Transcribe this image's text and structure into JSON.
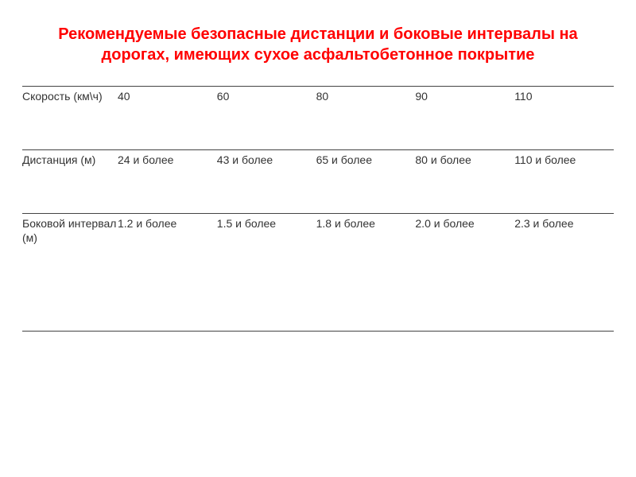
{
  "title": "Рекомендуемые безопасные дистанции и боковые интервалы на дорогах, имеющих сухое асфальтобетонное покрытие",
  "rows": [
    {
      "label": "Скорость (км\\ч)",
      "cells": [
        "40",
        "60",
        "80",
        "90",
        "110"
      ]
    },
    {
      "label": "Дистанция (м)",
      "cells": [
        "24 и более",
        "43 и более",
        "65 и более",
        "80 и более",
        "110 и более"
      ]
    },
    {
      "label": "Боковой интервал (м)",
      "cells": [
        "1.2 и более",
        "1.5 и более",
        "1.8 и более",
        "2.0 и более",
        "2.3 и более"
      ]
    }
  ]
}
